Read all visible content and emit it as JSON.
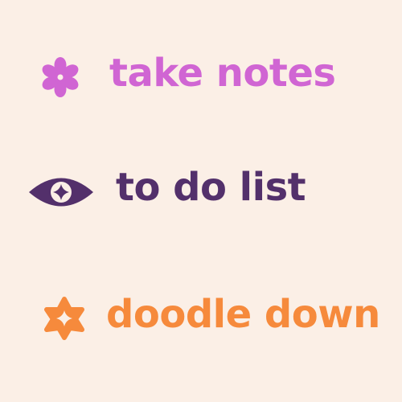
{
  "items": [
    {
      "label": "take notes",
      "icon": "flower-icon",
      "color": "#d065d3"
    },
    {
      "label": "to do list",
      "icon": "eye-icon",
      "color": "#53306b"
    },
    {
      "label": "doodle down",
      "icon": "star-badge-icon",
      "color": "#f68a3c"
    }
  ],
  "background": "#fbefe6"
}
